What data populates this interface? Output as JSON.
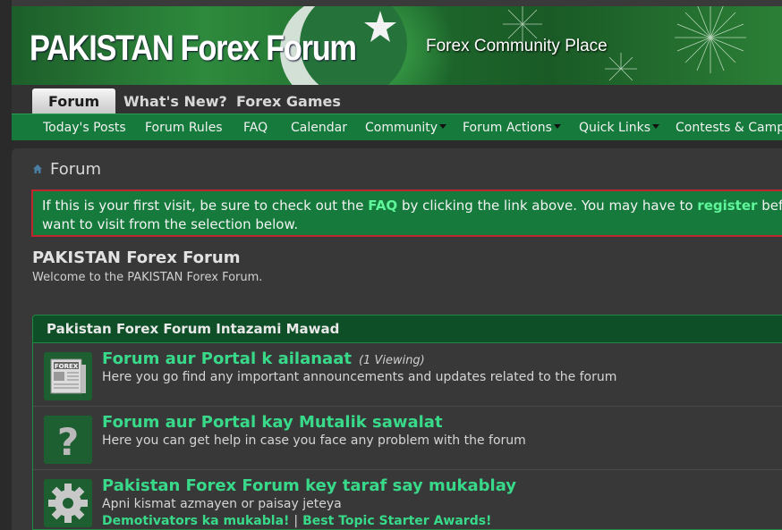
{
  "header": {
    "logo": "PAKISTAN Forex Forum",
    "tagline": "Forex Community Place"
  },
  "tabs": [
    {
      "label": "Forum",
      "active": true
    },
    {
      "label": "What's New?",
      "active": false
    },
    {
      "label": "Forex Games",
      "active": false
    }
  ],
  "nav": [
    {
      "label": "Today's Posts",
      "dropdown": false
    },
    {
      "label": "Forum Rules",
      "dropdown": false
    },
    {
      "label": "FAQ",
      "dropdown": false
    },
    {
      "label": "Calendar",
      "dropdown": false
    },
    {
      "label": "Community",
      "dropdown": true
    },
    {
      "label": "Forum Actions",
      "dropdown": true
    },
    {
      "label": "Quick Links",
      "dropdown": true
    },
    {
      "label": "Contests & Camp",
      "dropdown": false
    }
  ],
  "breadcrumb": {
    "label": "Forum",
    "icon": "home-icon"
  },
  "notice": {
    "part1": "If this is your first visit, be sure to check out the ",
    "faq": "FAQ",
    "part2": " by clicking the link above. You may have to ",
    "register": "register",
    "part3": " befo",
    "line2": "want to visit from the selection below."
  },
  "forum": {
    "title": "PAKISTAN Forex Forum",
    "description": "Welcome to the PAKISTAN Forex Forum."
  },
  "category": {
    "title": "Pakistan Forex Forum Intazami Mawad",
    "rows": [
      {
        "title": "Forum aur Portal k ailanaat",
        "viewing": "(1 Viewing)",
        "description": "Here you go find any important announcements and updates related to the forum",
        "icon": "newspaper-icon"
      },
      {
        "title": "Forum aur Portal kay Mutalik sawalat",
        "description": "Here you can get help in case you face any problem with the forum",
        "icon": "question-mark-icon"
      },
      {
        "title": "Pakistan Forex Forum key taraf say mukablay",
        "description": "Apni kismat azmayen or paisay jeteya",
        "sublinks": [
          "Demotivators ka mukabla!",
          "Best Topic Starter Awards!"
        ],
        "icon": "gear-icon"
      }
    ]
  },
  "colors": {
    "nav_green": "#167a3c",
    "link_green": "#39d98a",
    "notice_border": "#c0262e",
    "page_bg": "#2b2b2b",
    "content_bg": "#383838"
  }
}
